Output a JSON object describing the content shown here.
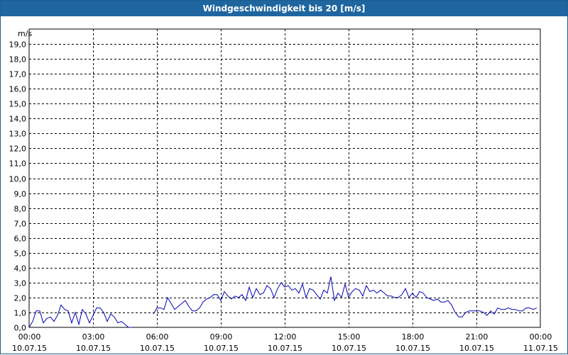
{
  "window": {
    "title": "Windgeschwindigkeit bis 20 [m/s]"
  },
  "colors": {
    "title_bar": "#1f66a0",
    "line": "#0000b4",
    "grid": "#000000"
  },
  "chart_data": {
    "type": "line",
    "ylabel": "m/s",
    "ylim": [
      0,
      20
    ],
    "xlim": [
      "2015-07-10T00:00",
      "2015-07-11T00:00"
    ],
    "grid": true,
    "legend": "none",
    "y_ticks": [
      "0,0",
      "1,0",
      "2,0",
      "3,0",
      "4,0",
      "5,0",
      "6,0",
      "7,0",
      "8,0",
      "9,0",
      "10,0",
      "11,0",
      "12,0",
      "13,0",
      "14,0",
      "15,0",
      "16,0",
      "17,0",
      "18,0",
      "19,0"
    ],
    "x_ticks": [
      {
        "time": "00:00",
        "date": "10.07.15"
      },
      {
        "time": "03:00",
        "date": "10.07.15"
      },
      {
        "time": "06:00",
        "date": "10.07.15"
      },
      {
        "time": "09:00",
        "date": "10.07.15"
      },
      {
        "time": "12:00",
        "date": "10.07.15"
      },
      {
        "time": "15:00",
        "date": "10.07.15"
      },
      {
        "time": "18:00",
        "date": "10.07.15"
      },
      {
        "time": "21:00",
        "date": "10.07.15"
      },
      {
        "time": "00:00",
        "date": "11.07.15"
      }
    ],
    "series": [
      {
        "segments": [
          {
            "x": [
              "00:00",
              "00:10",
              "00:20",
              "00:30",
              "00:40",
              "00:50",
              "01:00",
              "01:10",
              "01:20",
              "01:30",
              "01:40",
              "01:50",
              "02:00",
              "02:10",
              "02:20",
              "02:30",
              "02:40",
              "02:50",
              "03:00",
              "03:10",
              "03:20",
              "03:30",
              "03:40",
              "03:50",
              "04:00",
              "04:10",
              "04:20",
              "04:30",
              "04:40",
              "04:50",
              "05:00"
            ],
            "y": [
              0.0,
              0.4,
              1.1,
              1.1,
              0.3,
              0.6,
              0.7,
              0.4,
              0.8,
              1.5,
              1.2,
              1.1,
              0.3,
              1.0,
              0.2,
              1.2,
              0.9,
              0.3,
              0.8,
              1.3,
              1.3,
              1.0,
              0.4,
              0.9,
              0.7,
              0.3,
              0.4,
              0.2,
              0.0,
              0.0
            ]
          },
          {
            "x": [
              "05:50",
              "06:00",
              "06:10",
              "06:20",
              "06:30",
              "06:40",
              "06:50",
              "07:00",
              "07:10",
              "07:20",
              "07:30",
              "07:40",
              "07:50",
              "08:00",
              "08:10",
              "08:20",
              "08:30",
              "08:40",
              "08:50",
              "09:00",
              "09:10",
              "09:20",
              "09:30",
              "09:40",
              "09:50",
              "10:00",
              "10:10",
              "10:20",
              "10:30",
              "10:40",
              "10:50",
              "11:00",
              "11:10",
              "11:20",
              "11:30",
              "11:40",
              "11:50",
              "12:00",
              "12:10",
              "12:20",
              "12:30",
              "12:40",
              "12:50",
              "13:00",
              "13:10",
              "13:20",
              "13:30",
              "13:40",
              "13:50",
              "14:00",
              "14:10",
              "14:20",
              "14:30",
              "14:40",
              "14:50",
              "15:00",
              "15:10",
              "15:20",
              "15:30",
              "15:40",
              "15:50",
              "16:00",
              "16:10",
              "16:20",
              "16:30",
              "16:40",
              "16:50",
              "17:00",
              "17:10",
              "17:20",
              "17:30",
              "17:40",
              "17:50",
              "18:00",
              "18:10",
              "18:20",
              "18:30",
              "18:40",
              "18:50",
              "19:00",
              "19:10",
              "19:20",
              "19:30",
              "19:40",
              "19:50",
              "20:00",
              "20:10",
              "20:20",
              "20:30",
              "20:40",
              "20:50",
              "21:00",
              "21:10",
              "21:20",
              "21:30",
              "21:40",
              "21:50",
              "22:00",
              "22:10",
              "22:20",
              "22:30",
              "22:40",
              "22:50",
              "23:00",
              "23:10",
              "23:20",
              "23:30",
              "23:40",
              "23:50"
            ],
            "y": [
              0.9,
              1.3,
              1.3,
              1.2,
              2.0,
              1.6,
              1.2,
              1.4,
              1.6,
              1.8,
              1.4,
              1.1,
              1.1,
              1.3,
              1.7,
              1.9,
              2.0,
              2.2,
              2.2,
              1.8,
              2.4,
              2.1,
              1.9,
              2.1,
              2.0,
              2.2,
              1.8,
              2.7,
              2.0,
              2.6,
              2.2,
              2.3,
              2.8,
              2.6,
              2.0,
              2.6,
              3.0,
              2.7,
              2.8,
              2.5,
              2.6,
              2.3,
              2.9,
              2.0,
              2.6,
              2.5,
              2.2,
              1.9,
              2.5,
              2.3,
              3.4,
              1.8,
              2.3,
              2.0,
              2.9,
              2.0,
              2.4,
              2.6,
              2.5,
              2.1,
              2.8,
              2.4,
              2.5,
              2.3,
              2.5,
              2.3,
              2.1,
              2.1,
              2.0,
              2.0,
              2.2,
              2.6,
              2.0,
              2.3,
              2.0,
              2.4,
              2.3,
              2.0,
              1.9,
              1.8,
              1.9,
              1.7,
              1.7,
              1.8,
              1.5,
              1.0,
              0.7,
              0.7,
              1.0,
              1.1,
              1.1,
              1.1,
              1.1,
              1.0,
              0.8,
              1.1,
              0.9,
              1.3,
              1.2,
              1.2,
              1.3,
              1.2,
              1.2,
              1.1,
              1.1,
              1.3,
              1.3,
              1.2,
              1.3
            ]
          }
        ]
      }
    ]
  }
}
